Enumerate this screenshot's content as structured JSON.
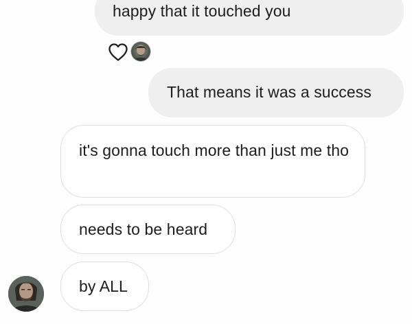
{
  "conversation": {
    "messages": [
      {
        "side": "sent",
        "text": "happy that it touched you"
      },
      {
        "side": "sent",
        "text": "That means it was a success"
      },
      {
        "side": "received",
        "text": "it's gonna touch more than just me tho"
      },
      {
        "side": "received",
        "text": "needs to be heard"
      },
      {
        "side": "received",
        "text": "by ALL"
      }
    ],
    "reaction": {
      "icon": "heart-outline-icon",
      "reactor_avatar": "profile-photo"
    },
    "colors": {
      "sent_bubble": "#efefef",
      "received_bubble_border": "#dedede",
      "text": "#1d1d1d",
      "background": "#fefefe"
    }
  }
}
